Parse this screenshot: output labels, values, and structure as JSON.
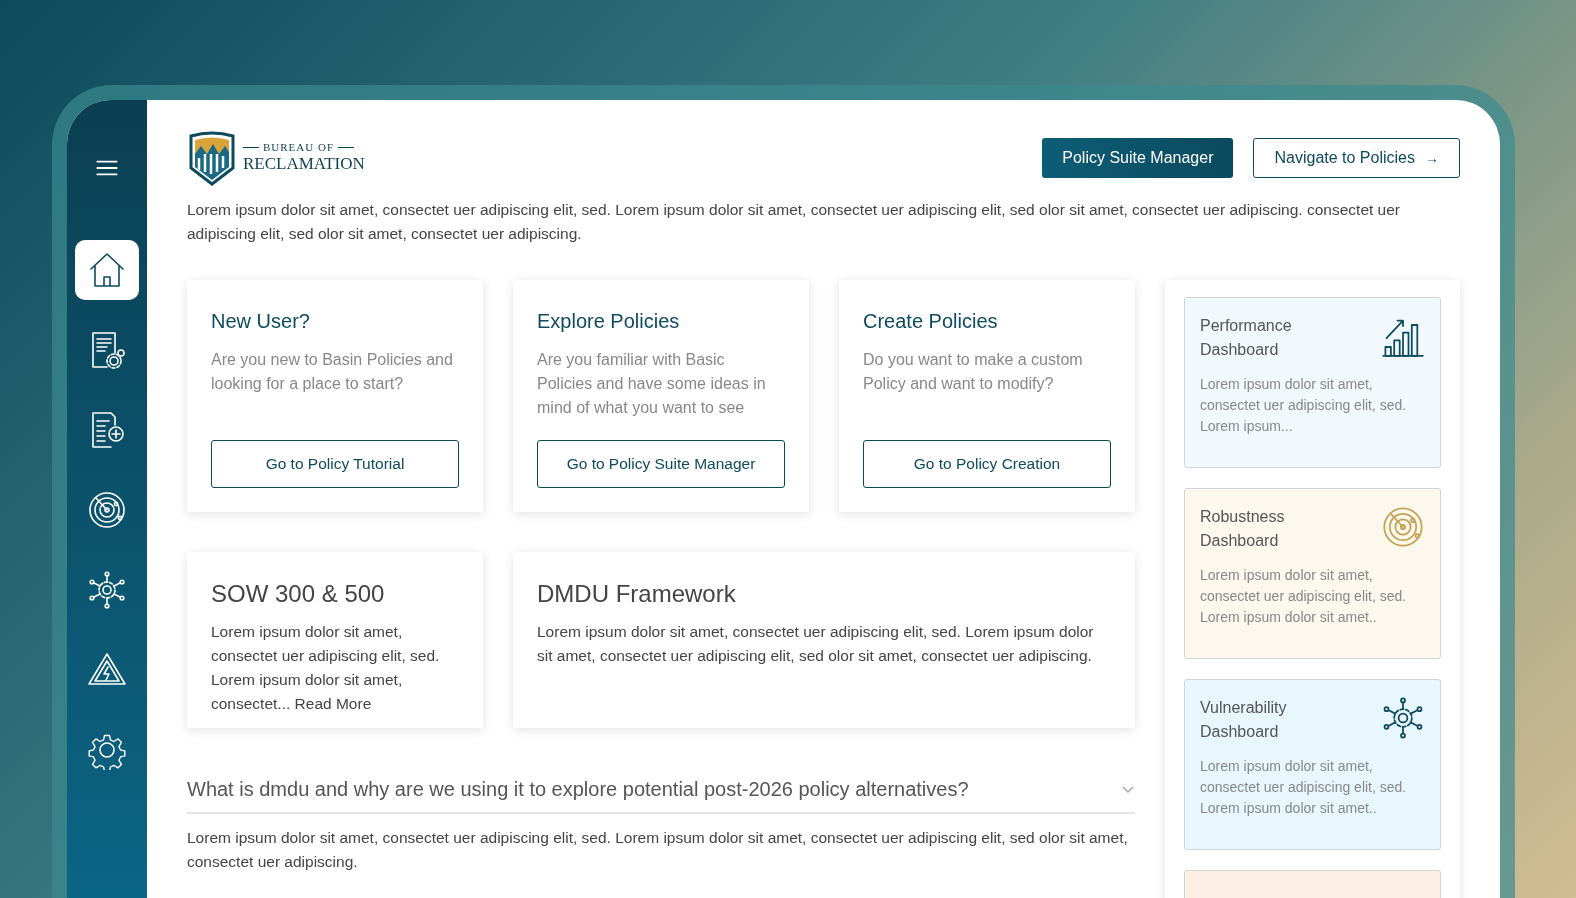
{
  "sidebar": {
    "items": [
      {
        "kind": "menu",
        "selected": false
      },
      {
        "kind": "home",
        "selected": true
      },
      {
        "kind": "document-gear",
        "selected": false
      },
      {
        "kind": "document-plus",
        "selected": false
      },
      {
        "kind": "radar",
        "selected": false
      },
      {
        "kind": "network",
        "selected": false
      },
      {
        "kind": "warning",
        "selected": false
      },
      {
        "kind": "settings",
        "selected": false
      }
    ]
  },
  "logo": {
    "line1": "BUREAU OF",
    "line2": "RECLAMATION"
  },
  "header_buttons": [
    {
      "label": "Policy Suite Manager",
      "kind": "primary"
    },
    {
      "label": "Navigate to Policies",
      "kind": "outline",
      "icon": "→"
    }
  ],
  "intro": "Lorem ipsum dolor sit amet, consectet uer adipiscing elit, sed. Lorem ipsum dolor sit amet, consectet uer adipiscing elit, sed olor sit amet, consectet uer adipiscing. consectet uer adipiscing elit, sed olor sit amet, consectet uer adipiscing.",
  "action_cards": [
    {
      "title": "New User?",
      "text": "Are you new to Basin Policies and looking for a place to start?",
      "button": "Go to Policy Tutorial"
    },
    {
      "title": "Explore Policies",
      "text": "Are you familiar with Basic Policies and have some ideas in mind of what you want to see",
      "button": "Go to Policy Suite Manager"
    },
    {
      "title": "Create Policies",
      "text": "Do you want to make a custom Policy and want to modify?",
      "button": "Go to Policy Creation"
    }
  ],
  "info_cards": [
    {
      "title": "SOW 300 & 500",
      "text": "Lorem ipsum dolor sit amet, consectet uer adipiscing elit, sed. Lorem ipsum dolor sit amet, consectet...",
      "link": "Read More"
    },
    {
      "title": "DMDU Framework",
      "text": "Lorem ipsum dolor sit amet, consectet uer adipiscing elit, sed. Lorem ipsum dolor sit amet, consectet uer adipiscing elit, sed olor sit amet, consectet uer adipiscing."
    }
  ],
  "faq": {
    "question": "What is dmdu and why are we using it to explore potential post-2026 policy alternatives?",
    "expanded": true,
    "answer": "Lorem ipsum dolor sit amet, consectet uer adipiscing elit, sed. Lorem ipsum dolor sit amet, consectet uer adipiscing elit, sed olor sit amet, consectet uer adipiscing."
  },
  "dashboards": [
    {
      "kind": "chart",
      "color": "#f2f9fd",
      "title": "Performance Dashboard",
      "text": "Lorem ipsum dolor sit amet, consectet uer adipiscing elit, sed. Lorem ipsum..."
    },
    {
      "kind": "radar",
      "color": "#fdf8ee",
      "title": "Robustness Dashboard",
      "text": "Lorem ipsum dolor sit amet, consectet uer adipiscing elit, sed. Lorem ipsum dolor sit amet.."
    },
    {
      "kind": "network",
      "color": "#e8f7fd",
      "title": "Vulnerability Dashboard",
      "text": "Lorem ipsum dolor sit amet, consectet uer adipiscing elit, sed. Lorem ipsum dolor sit amet.."
    },
    {
      "color": "#fdeee4"
    }
  ]
}
